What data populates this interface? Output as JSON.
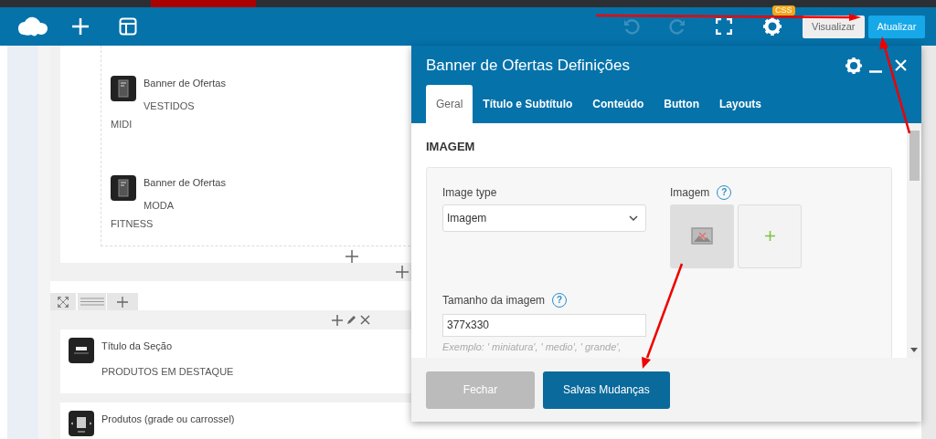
{
  "toolbar": {
    "badge": "CSS",
    "buttons": [
      {
        "label": "Visualizar",
        "kind": "secondary"
      },
      {
        "label": "Atualizar",
        "kind": "primary"
      }
    ]
  },
  "canvas": {
    "banners": [
      {
        "title": "Banner de Ofertas",
        "lines": [
          "VESTIDOS",
          "MIDI"
        ]
      },
      {
        "title": "Banner de Ofertas",
        "lines": [
          "MODA",
          "FITNESS"
        ]
      }
    ],
    "section_widgets": [
      {
        "title": "Título da Seção",
        "text": "PRODUTOS EM DESTAQUE",
        "kind": "title"
      },
      {
        "title": "Produtos (grade ou carrossel)",
        "kind": "products"
      }
    ]
  },
  "modal": {
    "title": "Banner de Ofertas Definições",
    "tabs": [
      {
        "label": "Geral",
        "selected": true
      },
      {
        "label": "Título e Subtítulo",
        "selected": false
      },
      {
        "label": "Conteúdo",
        "selected": false
      },
      {
        "label": "Button",
        "selected": false
      },
      {
        "label": "Layouts",
        "selected": false
      }
    ],
    "section_heading": "IMAGEM",
    "image_type": {
      "label": "Image type",
      "value": "Imagem"
    },
    "image": {
      "label": "Imagem",
      "help": "?"
    },
    "image_size": {
      "label": "Tamanho da imagem",
      "help": "?",
      "value": "377x330",
      "hint": "Exemplo: ' miniatura', ' medio', ' grande',"
    },
    "buttons": [
      {
        "label": "Fechar",
        "kind": "secondary"
      },
      {
        "label": "Salvas Mudanças",
        "kind": "primary"
      }
    ]
  }
}
